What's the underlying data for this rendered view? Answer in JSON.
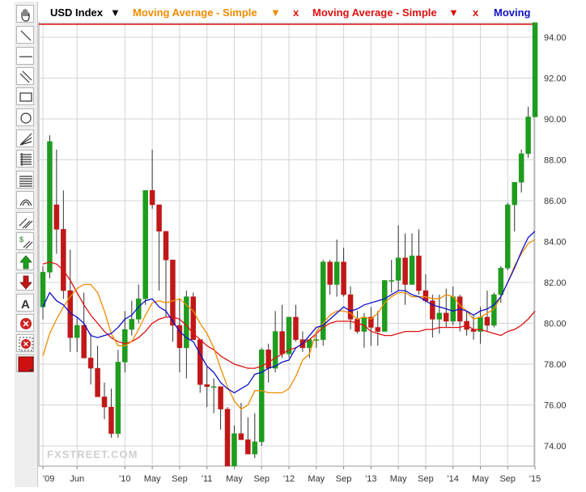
{
  "legend": {
    "symbol": "USD Index",
    "ma1": "Moving Average - Simple",
    "ma2": "Moving Average - Simple",
    "ma3": "Moving",
    "close": "x"
  },
  "watermark": "FXSTREET.COM",
  "toolbar": {
    "tools": [
      "hand-icon",
      "line-icon",
      "horizontal-line-icon",
      "parallel-lines-icon",
      "rectangle-icon",
      "circle-icon",
      "fan-icon",
      "fibonacci-retracement-icon",
      "fibonacci-levels-icon",
      "arc-icon",
      "channel-icon",
      "price-channel-icon",
      "buy-arrow-icon",
      "sell-arrow-icon",
      "text-icon",
      "delete-icon",
      "delete-all-icon",
      "color-picker-icon"
    ]
  },
  "colors": {
    "up": "#1e9c1e",
    "down": "#c01818",
    "ma_orange": "#f08c00",
    "ma_red": "#e01010",
    "ma_blue": "#1010c8",
    "grid": "#d4d4d4"
  },
  "chart_data": {
    "type": "candlestick",
    "ylim": [
      73,
      95
    ],
    "yticks": [
      74,
      76,
      78,
      80,
      82,
      84,
      86,
      88,
      90,
      92,
      94
    ],
    "ytick_labels": [
      "74.00",
      "76.00",
      "78.00",
      "80.00",
      "82.00",
      "84.00",
      "86.00",
      "88.00",
      "90.00",
      "92.00",
      "94.00"
    ],
    "xticks": [
      {
        "i": 0,
        "label": "'09"
      },
      {
        "i": 5,
        "label": "Jun"
      },
      {
        "i": 12,
        "label": "'10"
      },
      {
        "i": 16,
        "label": "May"
      },
      {
        "i": 20,
        "label": "Sep"
      },
      {
        "i": 24,
        "label": "'11"
      },
      {
        "i": 28,
        "label": "May"
      },
      {
        "i": 32,
        "label": "Sep"
      },
      {
        "i": 36,
        "label": "'12"
      },
      {
        "i": 40,
        "label": "May"
      },
      {
        "i": 44,
        "label": "Sep"
      },
      {
        "i": 48,
        "label": "'13"
      },
      {
        "i": 52,
        "label": "May"
      },
      {
        "i": 56,
        "label": "Sep"
      },
      {
        "i": 60,
        "label": "'14"
      },
      {
        "i": 64,
        "label": "May"
      },
      {
        "i": 68,
        "label": "Sep"
      },
      {
        "i": 72,
        "label": "'15"
      }
    ],
    "ohlc": [
      [
        80.8,
        82.8,
        80.2,
        82.5
      ],
      [
        82.5,
        89.2,
        82.2,
        88.9
      ],
      [
        85.8,
        88.5,
        83.4,
        84.6
      ],
      [
        84.6,
        86.5,
        81.2,
        81.6
      ],
      [
        81.6,
        83.6,
        78.6,
        79.3
      ],
      [
        79.3,
        80.3,
        78.6,
        79.9
      ],
      [
        79.9,
        81.5,
        78.7,
        78.3
      ],
      [
        78.3,
        79.5,
        77.0,
        77.8
      ],
      [
        77.8,
        78.9,
        77.2,
        76.4
      ],
      [
        76.4,
        77.1,
        75.3,
        75.9
      ],
      [
        75.9,
        76.8,
        74.4,
        74.6
      ],
      [
        74.6,
        78.7,
        74.4,
        78.1
      ],
      [
        78.1,
        80.6,
        77.6,
        79.7
      ],
      [
        79.7,
        81.1,
        79.4,
        80.2
      ],
      [
        80.2,
        81.9,
        80.0,
        81.2
      ],
      [
        81.2,
        86.3,
        80.9,
        86.5
      ],
      [
        86.5,
        88.5,
        85.6,
        85.8
      ],
      [
        85.8,
        84.9,
        81.6,
        84.5
      ],
      [
        84.5,
        83.4,
        80.3,
        83.1
      ],
      [
        83.1,
        82.1,
        79.1,
        79.9
      ],
      [
        79.9,
        81.2,
        77.6,
        78.8
      ],
      [
        78.8,
        81.6,
        77.3,
        81.3
      ],
      [
        81.3,
        81.5,
        79.4,
        79.2
      ],
      [
        79.2,
        79.2,
        76.6,
        77.0
      ],
      [
        77.0,
        77.9,
        75.9,
        76.9
      ],
      [
        76.9,
        77.3,
        75.6,
        76.9
      ],
      [
        76.9,
        75.4,
        74.8,
        75.8
      ],
      [
        75.8,
        75.9,
        72.9,
        73.0
      ],
      [
        73.0,
        75.0,
        72.8,
        74.6
      ],
      [
        74.6,
        76.1,
        74.3,
        74.3
      ],
      [
        74.3,
        75.4,
        73.9,
        73.6
      ],
      [
        73.6,
        75.6,
        73.4,
        74.2
      ],
      [
        74.2,
        78.8,
        74.0,
        78.7
      ],
      [
        78.7,
        79.0,
        77.1,
        77.8
      ],
      [
        77.8,
        80.6,
        77.6,
        79.6
      ],
      [
        79.6,
        80.9,
        78.3,
        78.5
      ],
      [
        78.5,
        80.3,
        78.3,
        80.3
      ],
      [
        80.3,
        80.9,
        79.1,
        79.2
      ],
      [
        79.2,
        79.6,
        78.6,
        78.8
      ],
      [
        78.8,
        78.9,
        78.3,
        79.2
      ],
      [
        79.2,
        79.5,
        78.8,
        79.2
      ],
      [
        79.2,
        83.1,
        78.9,
        83.0
      ],
      [
        83.0,
        83.1,
        81.4,
        81.9
      ],
      [
        81.9,
        84.1,
        81.3,
        83.0
      ],
      [
        83.0,
        83.7,
        81.3,
        81.4
      ],
      [
        81.4,
        81.8,
        79.7,
        80.2
      ],
      [
        80.2,
        80.6,
        79.5,
        79.6
      ],
      [
        79.6,
        80.5,
        78.8,
        80.3
      ],
      [
        80.3,
        80.8,
        78.9,
        79.8
      ],
      [
        79.8,
        80.6,
        78.9,
        79.6
      ],
      [
        79.6,
        82.1,
        79.7,
        82.1
      ],
      [
        82.1,
        83.1,
        81.5,
        82.1
      ],
      [
        82.1,
        84.8,
        81.6,
        83.2
      ],
      [
        83.2,
        84.4,
        80.9,
        81.9
      ],
      [
        81.9,
        84.4,
        82.9,
        83.3
      ],
      [
        83.3,
        84.6,
        81.4,
        81.6
      ],
      [
        81.6,
        82.4,
        81.0,
        81.1
      ],
      [
        81.1,
        81.4,
        79.3,
        80.2
      ],
      [
        80.2,
        81.4,
        79.5,
        80.5
      ],
      [
        80.5,
        81.7,
        79.8,
        80.1
      ],
      [
        80.1,
        81.8,
        79.9,
        81.3
      ],
      [
        81.3,
        81.4,
        79.6,
        80.1
      ],
      [
        80.1,
        80.6,
        79.4,
        79.7
      ],
      [
        79.7,
        80.4,
        79.2,
        79.6
      ],
      [
        79.6,
        80.8,
        79.0,
        80.3
      ],
      [
        80.3,
        81.6,
        79.6,
        79.9
      ],
      [
        79.9,
        81.5,
        79.8,
        81.4
      ],
      [
        81.4,
        82.8,
        81.0,
        82.7
      ],
      [
        82.7,
        85.9,
        82.6,
        85.8
      ],
      [
        85.8,
        86.8,
        84.5,
        86.9
      ],
      [
        86.9,
        88.5,
        86.4,
        88.3
      ],
      [
        88.3,
        90.6,
        88.1,
        90.1
      ],
      [
        90.1,
        95.7,
        90.2,
        94.8
      ]
    ],
    "ma_red": [
      82.9,
      83.0,
      82.9,
      82.6,
      82.1,
      81.5,
      80.9,
      80.4,
      80.0,
      79.6,
      79.3,
      79.1,
      79.0,
      79.1,
      79.3,
      79.6,
      80.0,
      80.2,
      80.3,
      80.3,
      80.2,
      79.9,
      79.5,
      79.2,
      78.9,
      78.7,
      78.4,
      78.2,
      78.0,
      77.9,
      77.8,
      77.8,
      77.9,
      78.1,
      78.3,
      78.5,
      78.7,
      78.8,
      79.0,
      79.2,
      79.5,
      79.8,
      80.0,
      80.1,
      80.1,
      80.1,
      80.0,
      79.9,
      79.6,
      79.5,
      79.4,
      79.4,
      79.5,
      79.6,
      79.6,
      79.6,
      79.7,
      79.7,
      79.8,
      79.8,
      79.8,
      79.8,
      79.9,
      79.7,
      79.7,
      79.6,
      79.5,
      79.4,
      79.6,
      79.7,
      79.9,
      80.2,
      80.6
    ],
    "ma_orange": [
      78.4,
      79.5,
      80.2,
      80.8,
      81.3,
      81.7,
      81.9,
      81.9,
      81.5,
      80.6,
      79.5,
      78.9,
      78.9,
      79.1,
      79.7,
      80.4,
      81.0,
      81.1,
      81.0,
      81.1,
      81.2,
      80.9,
      80.6,
      80.0,
      79.5,
      78.8,
      77.8,
      76.9,
      76.2,
      75.8,
      76.0,
      76.7,
      76.7,
      76.6,
      76.6,
      76.6,
      76.8,
      77.4,
      78.2,
      78.5,
      79.6,
      80.0,
      80.4,
      80.6,
      80.6,
      80.5,
      80.2,
      80.3,
      80.2,
      80.5,
      81.0,
      81.3,
      81.5,
      81.5,
      81.3,
      81.3,
      81.3,
      81.2,
      81.2,
      81.4,
      81.3,
      80.9,
      80.6,
      80.2,
      80.3,
      80.5,
      80.7,
      81.3,
      82.0,
      82.8,
      83.4,
      83.9,
      84.1
    ],
    "ma_blue": [
      80.8,
      81.5,
      81.1,
      80.9,
      80.5,
      80.3,
      80.0,
      79.4,
      79.3,
      79.4,
      79.5,
      79.8,
      80.2,
      80.4,
      80.8,
      81.1,
      81.2,
      80.8,
      80.6,
      80.1,
      79.6,
      79.3,
      79.1,
      78.5,
      77.9,
      77.6,
      77.1,
      76.8,
      76.6,
      76.8,
      77.0,
      77.5,
      77.6,
      77.8,
      77.9,
      78.1,
      78.2,
      78.8,
      79.0,
      79.4,
      79.8,
      79.9,
      80.2,
      80.5,
      80.8,
      80.6,
      80.7,
      80.9,
      81.0,
      81.1,
      81.2,
      81.4,
      81.6,
      81.6,
      81.4,
      81.3,
      81.1,
      80.9,
      80.8,
      80.7,
      80.6,
      80.7,
      80.6,
      80.4,
      80.6,
      80.7,
      80.9,
      81.3,
      82.0,
      82.7,
      83.5,
      84.2,
      84.5
    ]
  }
}
